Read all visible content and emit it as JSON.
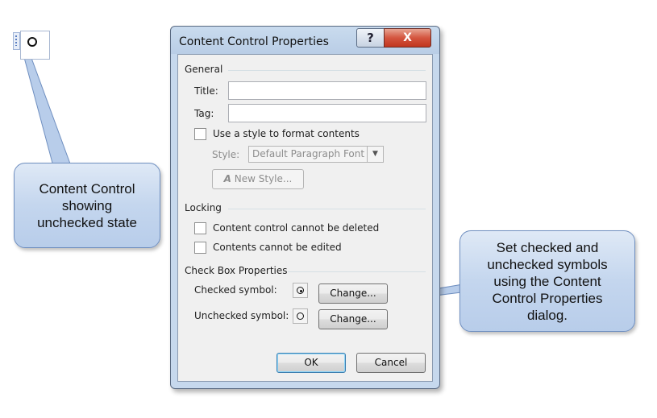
{
  "callouts": {
    "left": "Content Control\nshowing\nunchecked state",
    "right": "Set checked and\nunchecked symbols\nusing the Content\nControl Properties\ndialog."
  },
  "dialog": {
    "title": "Content Control Properties",
    "help_label": "?",
    "close_label": "X",
    "general": {
      "section_label": "General",
      "title_label": "Title:",
      "title_value": "",
      "tag_label": "Tag:",
      "tag_value": "",
      "use_style_label": "Use a style to format contents",
      "use_style_checked": false,
      "style_label": "Style:",
      "style_value": "Default Paragraph Font",
      "new_style_label": "New Style..."
    },
    "locking": {
      "section_label": "Locking",
      "cannot_delete_label": "Content control cannot be deleted",
      "cannot_delete_checked": false,
      "cannot_edit_label": "Contents cannot be edited",
      "cannot_edit_checked": false
    },
    "checkbox_props": {
      "section_label": "Check Box Properties",
      "checked_label": "Checked symbol:",
      "unchecked_label": "Unchecked symbol:",
      "change_label": "Change..."
    },
    "ok_label": "OK",
    "cancel_label": "Cancel"
  },
  "icons": {
    "help": "question-mark-icon",
    "close": "close-icon",
    "new_style": "new-style-icon",
    "dropdown": "chevron-down-icon"
  }
}
